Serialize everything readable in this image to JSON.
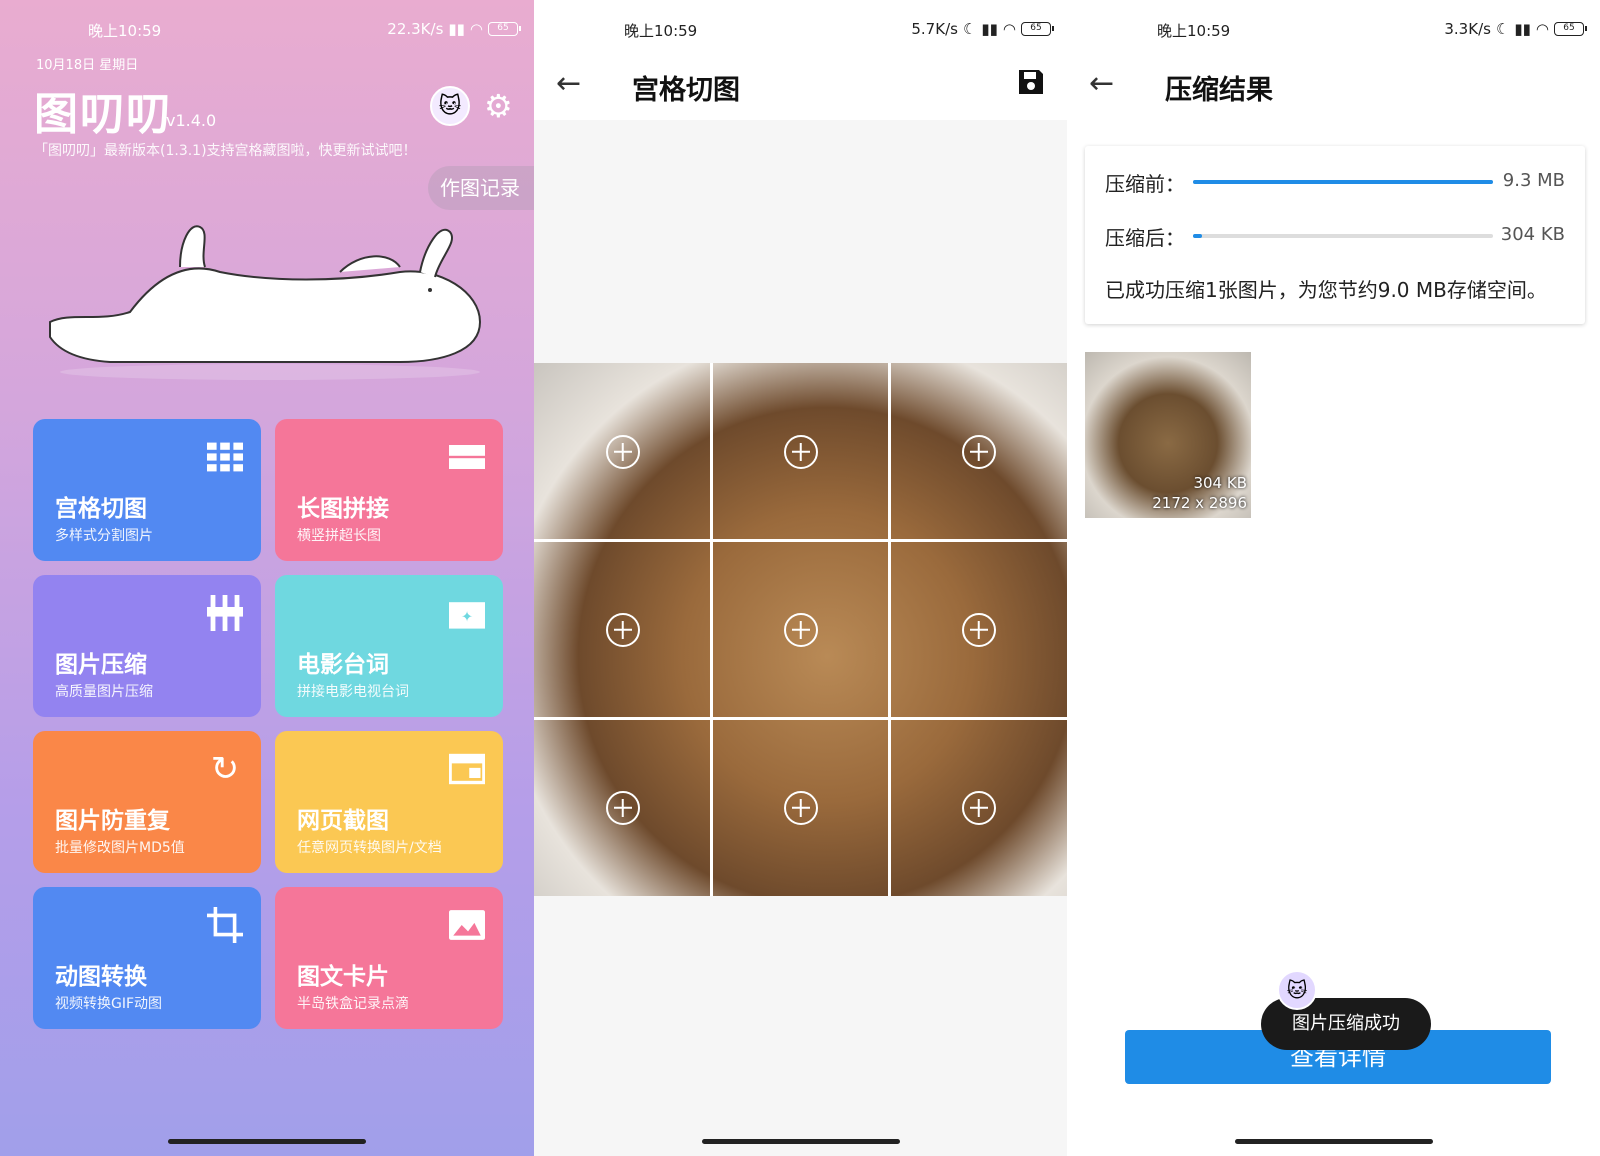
{
  "status_left": {
    "time": "晚上10:59",
    "speed": "22.3K/s",
    "battery": "65"
  },
  "status_mid": {
    "time": "晚上10:59",
    "speed": "5.7K/s",
    "battery": "65"
  },
  "status_right": {
    "time": "晚上10:59",
    "speed": "3.3K/s",
    "battery": "65"
  },
  "home": {
    "date": "10月18日 星期日",
    "title": "图叨叨",
    "version": "v1.4.0",
    "notice": "「图叨叨」最新版本(1.3.1)支持宫格藏图啦，快更新试试吧！",
    "history_label": "作图记录",
    "cards": [
      {
        "title": "宫格切图",
        "sub": "多样式分割图片",
        "icon": "grid-icon"
      },
      {
        "title": "长图拼接",
        "sub": "横竖拼超长图",
        "icon": "stack-icon"
      },
      {
        "title": "图片压缩",
        "sub": "高质量图片压缩",
        "icon": "compress-icon"
      },
      {
        "title": "电影台词",
        "sub": "拼接电影电视台词",
        "icon": "movie-icon"
      },
      {
        "title": "图片防重复",
        "sub": "批量修改图片MD5值",
        "icon": "refresh-icon"
      },
      {
        "title": "网页截图",
        "sub": "任意网页转换图片/文档",
        "icon": "webpage-icon"
      },
      {
        "title": "动图转换",
        "sub": "视频转换GIF动图",
        "icon": "crop-icon"
      },
      {
        "title": "图文卡片",
        "sub": "半岛铁盒记录点滴",
        "icon": "image-icon"
      }
    ]
  },
  "grid_page": {
    "title": "宫格切图"
  },
  "result_page": {
    "title": "压缩结果",
    "before_label": "压缩前：",
    "before_value": "9.3 MB",
    "before_fraction": 1.0,
    "after_label": "压缩后：",
    "after_value": "304 KB",
    "after_fraction": 0.03,
    "summary": "已成功压缩1张图片，为您节约9.0 MB存储空间。",
    "thumb_size": "304 KB",
    "thumb_dims": "2172 x 2896",
    "button_label": "查看详情",
    "toast": "图片压缩成功"
  },
  "colors": {
    "accent": "#1f8ce6"
  }
}
